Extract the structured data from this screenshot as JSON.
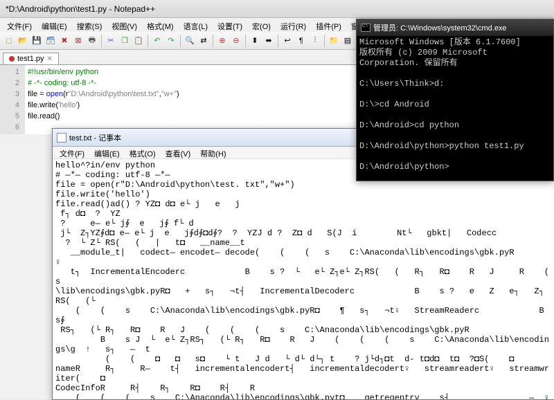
{
  "npp": {
    "title": "*D:\\Android\\python\\test1.py - Notepad++",
    "menus": [
      "文件(F)",
      "编辑(E)",
      "搜索(S)",
      "视图(V)",
      "格式(M)",
      "语言(L)",
      "设置(T)",
      "宏(O)",
      "运行(R)",
      "插件(P)",
      "窗口(W)",
      "?"
    ],
    "tab": {
      "label": "test1.py"
    },
    "lines": [
      "1",
      "2",
      "3",
      "4",
      "5",
      "6"
    ],
    "code": {
      "l1": "#!!usr/bin/env python",
      "l2": "# -*- coding: utf-8 -*-",
      "l3a": "file = ",
      "l3b": "open",
      "l3c": "(r",
      "l3d": "\"D:\\Android\\python\\test.txt\"",
      "l3e": ",",
      "l3f": "\"w+\"",
      "l3g": ")",
      "l4a": "file.write(",
      "l4b": "'hello'",
      "l4c": ")",
      "l5": "file.read()"
    }
  },
  "notepad": {
    "title": "test.txt - 记事本",
    "menus": [
      "文件(F)",
      "编辑(E)",
      "格式(O)",
      "查看(V)",
      "帮助(H)"
    ],
    "content": "hello^?in/env python\n# —*— coding: utf-8 —*—\nfile = open(r\"D:\\Android\\python\\test. txt\",\"w+\")\nfile.write('hello')\nfile.read()ad() ? YZ◘ d◘ e└ j   e   j\n f┐ d◘  ?  YZ\n ?     e— e└ j∮  e   j∮ f└ d\n j└  Z┐YZ∮d◘ e— e└ j  e   j∮d∮◘d∮?  ?  YZJ d ?  Z◘ d   S(J  i        Nt└   gbkt|   Codecc\n  ?  └ Z└ RS(   (   |   t◘   __name__t\n   __module_t|   codect— encodet— decode(    (    (   s    C:\\Anaconda\\lib\\encodings\\gbk.pyR       ♀\n   t┐  IncrementalEncoderc            B    s ?  └   e└ Z┐e└ Z┐RS(   (   R┐   R◘    R   J     R    (    s\n\\lib\\encodings\\gbk.pyR◘   +   s┐   ¬t┤   IncrementalDecoderc            B    s ?   e   Z   e┐   Z┐  RS(   (└\n    (    (    s    C:\\Anaconda\\lib\\encodings\\gbk.pyR◘    ¶   s┐   ¬t♀   StreamReaderc            B    s∮\n RS┐   (└ R┐   R◘    R   J    (    (    (    s    C:\\Anaconda\\lib\\encodings\\gbk.pyR\n         B    s J  └  e└ Z┐RS┐   (└ R┐   R◘    R   J    (    (    (    s    C:\\Anaconda\\lib\\encodings\\g  ↑   s┐   —  t\n          (    (    ◘   ◘   s◘    └ t   J d   └ d└ d└┐ t    ? j└d┐◘t  d- t◘d◘  t◘  ?◘S(    ◘\nnameR     R┐     R—    t┤   incrementalencodert┤   incrementaldecodert♀   streamreadert♀   streamwriter(    ◘\nCodecInfoR     R┤    R┐    R◘    R┤    R\n    (    (    (    s    C:\\Anaconda\\lib\\encodings\\gbk.pyt◘    getregentry    s┤                —  ♀   (\n  _codecs_cnR→    t◘   __multibytecodect   mbct◘   getcodecR┐    R   t←   MultibyteIncrementalEncoderR◘\nMultibyteIncrementalDecoderR◘    t←   MultibyteStreamReaderR    t←   MultibyteStreamWriterR\n   (    (    (    s    C:\\Anaconda\\lib\\encodings\\gbk.pyt◘   <module>◘   s┤    ♀       ?\n↑♪ §1??◘↔ 蘏?燋?                                              ↑ T]?粩?                                                                                ?¶   \\^???  ?  ◘?  €?? _\n  jk?熽?j c^  ? ◘◘ e?   @?◘<?                                   J蹦?邬                                                                       l?   ◘◘ e?   @?◘◘<?\n   @=— ?          ◘  1     04q◘i∮?□？    ?"
  },
  "cmd": {
    "title": "管理员: C:\\Windows\\system32\\cmd.exe",
    "content": "Microsoft Windows [版本 6.1.7600]\n版权所有 (c) 2009 Microsoft Corporation. 保留所有\n\nC:\\Users\\Think>d:\n\nD:\\>cd Android\n\nD:\\Android>cd python\n\nD:\\Android\\python>python test1.py\n\nD:\\Android\\python>"
  }
}
